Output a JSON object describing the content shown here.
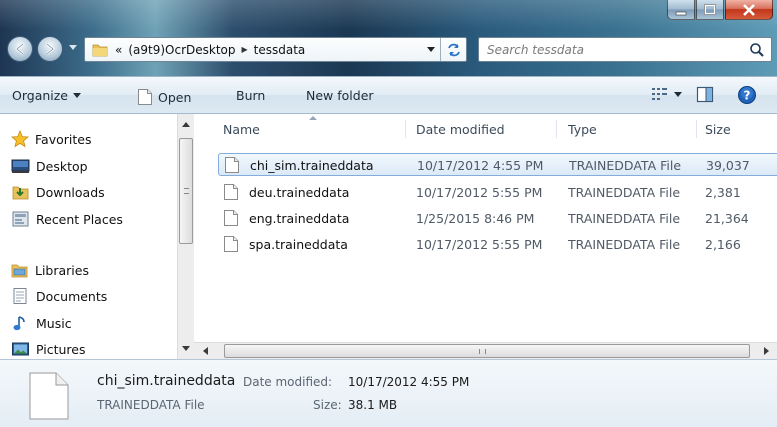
{
  "window": {
    "controls": {
      "minimize": "minimize",
      "maximize": "maximize",
      "close": "close"
    }
  },
  "address_bar": {
    "overflow": "«",
    "crumbs": [
      "(a9t9)OcrDesktop",
      "tessdata"
    ]
  },
  "search": {
    "placeholder": "Search tessdata"
  },
  "toolbar": {
    "organize": "Organize",
    "open": "Open",
    "burn": "Burn",
    "new_folder": "New folder"
  },
  "nav": {
    "favorites": {
      "label": "Favorites",
      "items": [
        "Desktop",
        "Downloads",
        "Recent Places"
      ]
    },
    "libraries": {
      "label": "Libraries",
      "items": [
        "Documents",
        "Music",
        "Pictures"
      ]
    }
  },
  "columns": {
    "name": "Name",
    "date": "Date modified",
    "type": "Type",
    "size": "Size"
  },
  "files": [
    {
      "name": "chi_sim.traineddata",
      "date": "10/17/2012 4:55 PM",
      "type": "TRAINEDDATA File",
      "size": "39,037",
      "selected": true
    },
    {
      "name": "deu.traineddata",
      "date": "10/17/2012 5:55 PM",
      "type": "TRAINEDDATA File",
      "size": "2,381",
      "selected": false
    },
    {
      "name": "eng.traineddata",
      "date": "1/25/2015 8:46 PM",
      "type": "TRAINEDDATA File",
      "size": "21,364",
      "selected": false
    },
    {
      "name": "spa.traineddata",
      "date": "10/17/2012 5:55 PM",
      "type": "TRAINEDDATA File",
      "size": "2,166",
      "selected": false
    }
  ],
  "details": {
    "name": "chi_sim.traineddata",
    "date_label": "Date modified:",
    "date_value": "10/17/2012 4:55 PM",
    "type": "TRAINEDDATA File",
    "size_label": "Size:",
    "size_value": "38.1 MB"
  },
  "icons": {
    "back": "back-arrow-icon",
    "forward": "forward-arrow-icon",
    "folder": "folder-icon",
    "refresh": "refresh-icon",
    "search": "search-icon",
    "views": "views-icon",
    "preview_pane": "preview-pane-icon",
    "help": "help-icon",
    "file": "file-icon"
  },
  "colors": {
    "selection_border": "#84acdd",
    "selection_fill": "#dbe9f7",
    "toolbar": "#dde9f3",
    "close_button": "#c1361b"
  }
}
